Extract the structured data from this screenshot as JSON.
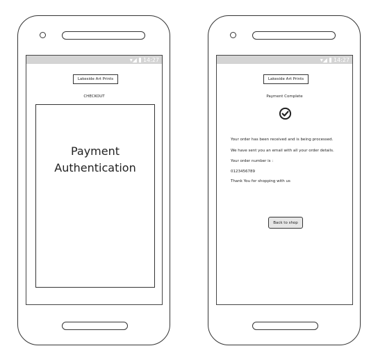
{
  "status_bar": {
    "time": "14:27"
  },
  "left_screen": {
    "brand_button": "Lakeside Art Prints",
    "heading": "CHECKOUT",
    "panel_line1": "Payment",
    "panel_line2": "Authentication"
  },
  "right_screen": {
    "brand_button": "Lakeside Art Prints",
    "heading": "Payment Complete",
    "status_icon": "check-circle-icon",
    "lines": [
      "Your order has been received and is being processed.",
      "We have sent you an email with all your order details.",
      "Your order number is :",
      "0123456789",
      "Thank You for shopping with us"
    ],
    "back_button": "Back to shop"
  }
}
